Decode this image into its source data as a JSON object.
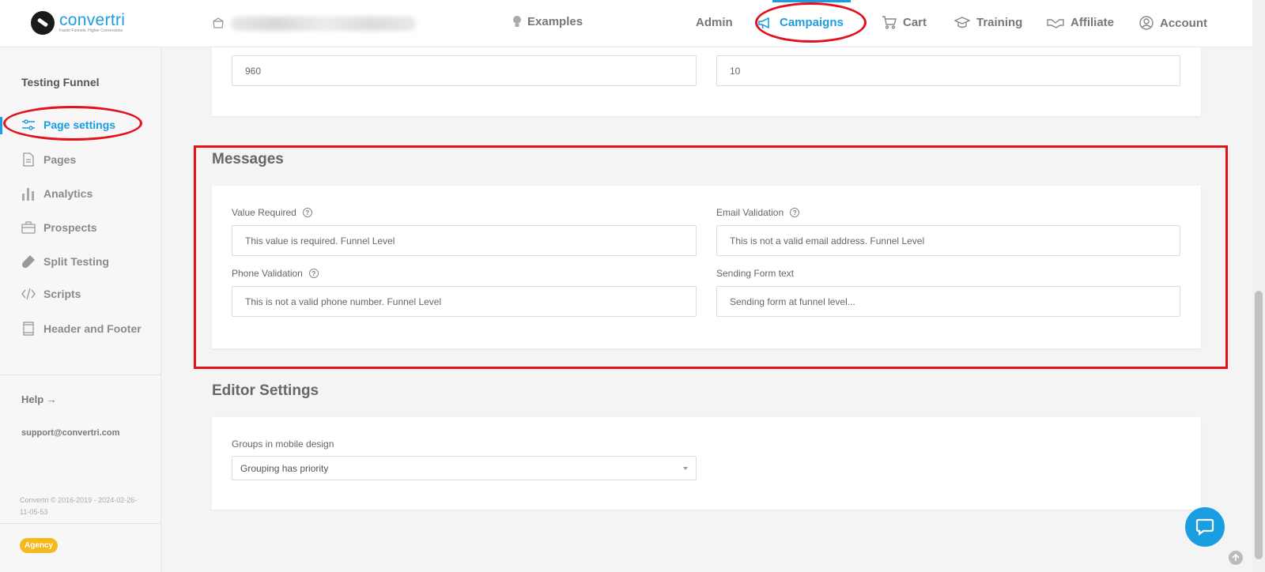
{
  "brand": {
    "name": "convertri",
    "tagline": "Faster Funnels, Higher Conversions"
  },
  "header": {
    "examples_label": "Examples",
    "nav": [
      {
        "label": "Admin",
        "icon": "none"
      },
      {
        "label": "Campaigns",
        "icon": "megaphone-icon",
        "active": true
      },
      {
        "label": "Cart",
        "icon": "cart-icon"
      },
      {
        "label": "Training",
        "icon": "graduation-cap-icon"
      },
      {
        "label": "Affiliate",
        "icon": "handshake-icon"
      },
      {
        "label": "Account",
        "icon": "user-circle-icon"
      }
    ]
  },
  "sidebar": {
    "funnel_name": "Testing Funnel",
    "items": [
      {
        "label": "Page settings",
        "icon": "sliders-icon",
        "active": true
      },
      {
        "label": "Pages",
        "icon": "document-icon"
      },
      {
        "label": "Analytics",
        "icon": "bar-chart-icon"
      },
      {
        "label": "Prospects",
        "icon": "briefcase-icon"
      },
      {
        "label": "Split Testing",
        "icon": "flask-icon"
      },
      {
        "label": "Scripts",
        "icon": "code-icon"
      },
      {
        "label": "Header and Footer",
        "icon": "layout-icon"
      }
    ],
    "help_label": "Help →",
    "support_email": "support@convertri.com",
    "copyright": "Convertri © 2016-2019 - 2024-02-26-11-05-53",
    "badge": "Agency"
  },
  "top_card": {
    "width_value": "960",
    "other_value": "10"
  },
  "messages": {
    "title": "Messages",
    "value_required_label": "Value Required",
    "value_required_value": "This value is required. Funnel Level",
    "email_validation_label": "Email Validation",
    "email_validation_value": "This is not a valid email address. Funnel Level",
    "phone_validation_label": "Phone Validation",
    "phone_validation_value": "This is not a valid phone number. Funnel Level",
    "sending_form_label": "Sending Form text",
    "sending_form_value": "Sending form at funnel level..."
  },
  "editor": {
    "title": "Editor Settings",
    "groups_label": "Groups in mobile design",
    "groups_value": "Grouping has priority"
  },
  "colors": {
    "accent": "#1a9ee2",
    "annotation": "#e3111b",
    "badge": "#f6b91c"
  }
}
